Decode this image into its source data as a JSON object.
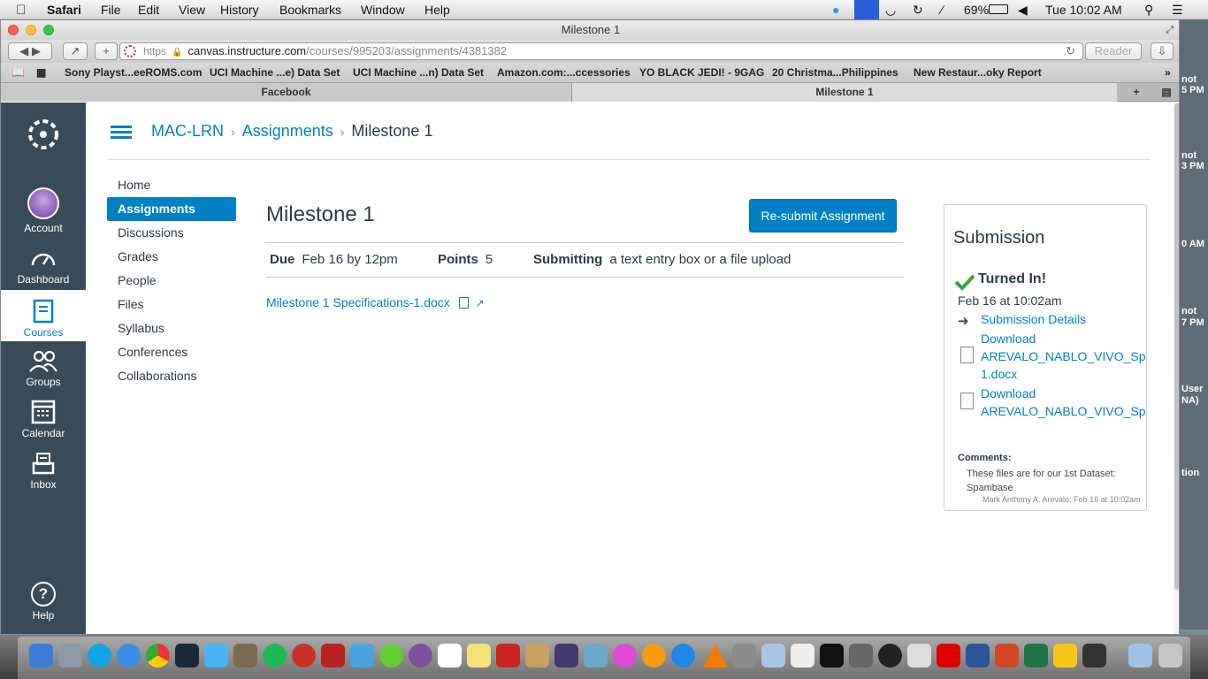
{
  "menubar": {
    "app": "Safari",
    "items": [
      "File",
      "Edit",
      "View",
      "History",
      "Bookmarks",
      "Window",
      "Help"
    ],
    "battery": "69%",
    "clock": "Tue 10:02 AM"
  },
  "window": {
    "title": "Milestone 1"
  },
  "toolbar": {
    "url_scheme": "https",
    "url_host": "canvas.instructure.com",
    "url_path": "/courses/995203/assignments/4381382",
    "reader": "Reader"
  },
  "bookmarks": [
    "Sony Playst...eeROMS.com",
    "UCI Machine ...e) Data Set",
    "UCI Machine ...n) Data Set",
    "Amazon.com:...ccessories",
    "YO BLACK JEDI! - 9GAG",
    "20 Christma...Philippines",
    "New Restaur...oky Report"
  ],
  "tabs": [
    "Facebook",
    "Milestone 1"
  ],
  "globalnav": {
    "account": "Account",
    "dashboard": "Dashboard",
    "courses": "Courses",
    "groups": "Groups",
    "calendar": "Calendar",
    "inbox": "Inbox",
    "help": "Help"
  },
  "breadcrumb": {
    "course": "MAC-LRN",
    "section": "Assignments",
    "current": "Milestone 1"
  },
  "coursenav": [
    "Home",
    "Assignments",
    "Discussions",
    "Grades",
    "People",
    "Files",
    "Syllabus",
    "Conferences",
    "Collaborations"
  ],
  "assignment": {
    "title": "Milestone 1",
    "resubmit": "Re-submit Assignment",
    "due_label": "Due",
    "due": "Feb 16 by 12pm",
    "points_label": "Points",
    "points": "5",
    "submitting_label": "Submitting",
    "submitting": "a text entry box or a file upload",
    "file": "Milestone 1 Specifications-1.docx"
  },
  "submission": {
    "title": "Submission",
    "status": "Turned In!",
    "date": "Feb 16 at 10:02am",
    "details_link": "Submission Details",
    "download1_a": "Download",
    "download1_b": "AREVALO_NABLO_VIVO_Spambase-",
    "download1_c": "1.docx",
    "download2_a": "Download",
    "download2_b": "AREVALO_NABLO_VIVO_Spambase",
    "comments_label": "Comments:",
    "comment": "These files are for our 1st Dataset: Spambase",
    "comment_by": "Mark Anthony A. Arevalo, Feb 16 at 10:02am"
  },
  "background_window": {
    "snippets": [
      "not",
      "5 PM",
      "not",
      "3 PM",
      "0 AM",
      "not",
      "7 PM",
      "User",
      "NA)",
      "tion"
    ]
  },
  "colors": {
    "canvas_blue": "#0081c6",
    "nav_dark": "#394b58",
    "success_green": "#3aa33a"
  }
}
